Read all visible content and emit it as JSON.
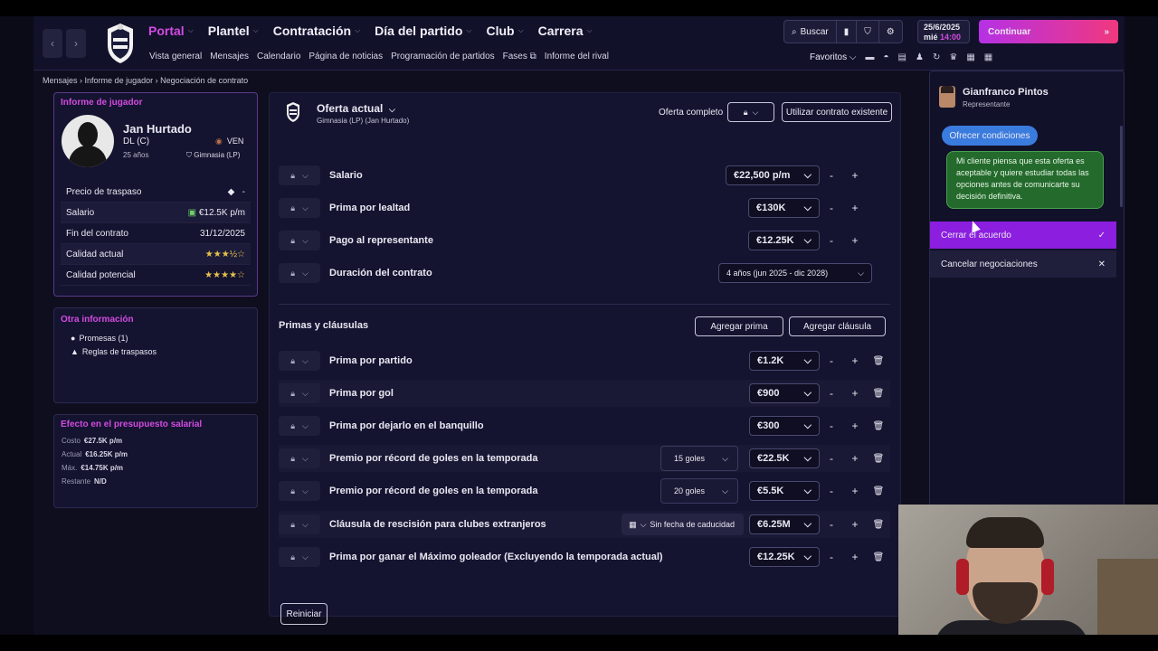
{
  "topbar": {
    "back_icon": "chevron-left-icon",
    "forward_icon": "chevron-right-icon",
    "menu": [
      {
        "label": "Portal",
        "active": true
      },
      {
        "label": "Plantel",
        "active": false
      },
      {
        "label": "Contratación",
        "active": false
      },
      {
        "label": "Día del partido",
        "active": false
      },
      {
        "label": "Club",
        "active": false
      },
      {
        "label": "Carrera",
        "active": false
      }
    ],
    "submenu": [
      "Vista general",
      "Mensajes",
      "Calendario",
      "Página de noticias",
      "Programación de partidos",
      "Fases",
      "Informe del rival"
    ],
    "search_label": "Buscar",
    "date": "25/6/2025",
    "weekday": "mié",
    "time": "14:00",
    "continue_label": "Continuar",
    "favorites_label": "Favoritos",
    "accent_color": "#d24be0"
  },
  "breadcrumb": [
    "Mensajes",
    "Informe de jugador",
    "Negociación de contrato"
  ],
  "player": {
    "panel_title": "Informe de jugador",
    "name": "Jan Hurtado",
    "position": "DL (C)",
    "age": "25 años",
    "nationality": "VEN",
    "club": "Gimnasia (LP)",
    "stats": [
      {
        "label": "Precio de traspaso",
        "value": "-"
      },
      {
        "label": "Salario",
        "value": "€12.5K p/m"
      },
      {
        "label": "Fin del contrato",
        "value": "31/12/2025"
      },
      {
        "label": "Calidad actual",
        "value": "★★★½☆",
        "rating": 3.5
      },
      {
        "label": "Calidad potencial",
        "value": "★★★★☆",
        "rating": 4
      }
    ]
  },
  "other_info": {
    "title": "Otra información",
    "items": [
      "Promesas (1)",
      "Reglas de traspasos"
    ]
  },
  "budget": {
    "title": "Efecto en el presupuesto salarial",
    "rows": [
      {
        "label": "Costo",
        "value": "€27.5K p/m"
      },
      {
        "label": "Actual",
        "value": "€16.25K p/m"
      },
      {
        "label": "Máx.",
        "value": "€14.75K p/m"
      },
      {
        "label": "Restante",
        "value": "N/D"
      }
    ]
  },
  "offer": {
    "title": "Oferta actual",
    "subtitle": "Gimnasia (LP) (Jan Hurtado)",
    "complete_label": "Oferta completo",
    "use_existing_label": "Utilizar contrato existente",
    "terms": [
      {
        "label": "Salario",
        "value": "€22,500 p/m"
      },
      {
        "label": "Prima por lealtad",
        "value": "€130K"
      },
      {
        "label": "Pago al representante",
        "value": "€12.25K"
      },
      {
        "label": "Duración del contrato",
        "value": "4 años (jun 2025 - dic 2028)"
      }
    ],
    "bonuses_title": "Primas y cláusulas",
    "add_bonus_label": "Agregar prima",
    "add_clause_label": "Agregar cláusula",
    "bonuses": [
      {
        "label": "Prima por partido",
        "value": "€1.2K"
      },
      {
        "label": "Prima por gol",
        "value": "€900"
      },
      {
        "label": "Prima por dejarlo en el banquillo",
        "value": "€300"
      },
      {
        "label": "Premio por récord de goles en la temporada",
        "extra": "15 goles",
        "value": "€22.5K"
      },
      {
        "label": "Premio por récord de goles en la temporada",
        "extra": "20 goles",
        "value": "€5.5K"
      },
      {
        "label": "Cláusula de rescisión para clubes extranjeros",
        "extra": "Sin fecha de caducidad",
        "value": "€6.25M"
      },
      {
        "label": "Prima por ganar el Máximo goleador (Excluyendo la temporada actual)",
        "value": "€12.25K"
      }
    ],
    "minus": "-",
    "plus": "+",
    "reset_label": "Reiniciar"
  },
  "chat": {
    "agent_name": "Gianfranco Pintos",
    "agent_role": "Representante",
    "my_message": "Ofrecer condiciones",
    "their_message": "Mi cliente piensa que esta oferta es aceptable y quiere estudiar todas las opciones antes de comunicarte su decisión definitiva.",
    "option_close": "Cerrar el acuerdo",
    "option_cancel": "Cancelar negociaciones",
    "option_close_color": "#8c1ee0",
    "bubble_me_color": "#3a7bde",
    "bubble_them_color": "#246a2c"
  }
}
